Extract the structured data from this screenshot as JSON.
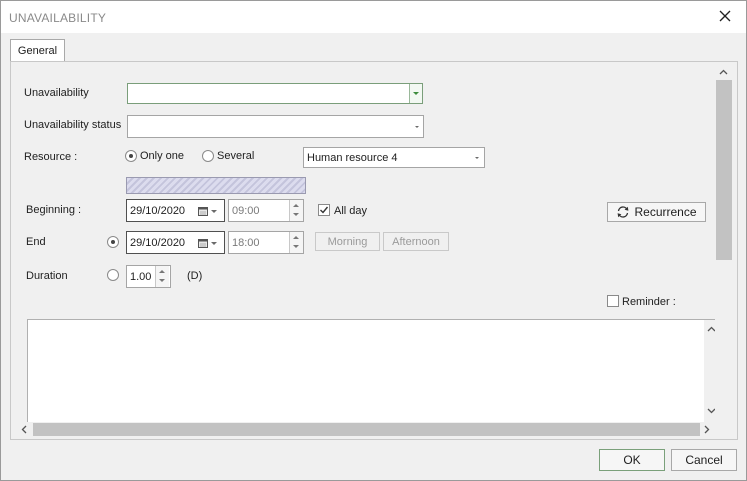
{
  "window": {
    "title": "UNAVAILABILITY"
  },
  "tabs": [
    {
      "label": "General"
    }
  ],
  "form": {
    "unavailability_label": "Unavailability",
    "unavailability_value": "",
    "status_label": "Unavailability status",
    "status_value": "",
    "resource_label": "Resource :",
    "resource_only_one": "Only one",
    "resource_several": "Several",
    "resource_value": "Human resource 4",
    "beginning_label": "Beginning :",
    "beginning_date": "29/10/2020",
    "beginning_time": "09:00",
    "all_day_label": "All day",
    "recurrence_label": "Recurrence",
    "end_label": "End",
    "end_date": "29/10/2020",
    "end_time": "18:00",
    "morning_label": "Morning",
    "afternoon_label": "Afternoon",
    "duration_label": "Duration",
    "duration_value": "1.00",
    "duration_unit": "(D)",
    "reminder_label": "Reminder :"
  },
  "footer": {
    "ok_label": "OK",
    "cancel_label": "Cancel"
  },
  "colors": {
    "accent_green": "#3c8c3c",
    "hatch": "#c4c4dc"
  }
}
